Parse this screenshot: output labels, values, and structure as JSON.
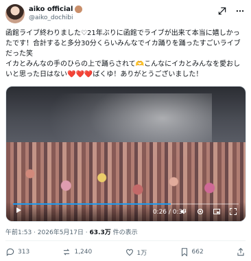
{
  "post": {
    "author_name": "aiko official",
    "author_handle": "@aiko_dochibi",
    "text": "函館ライブ終わりました♡21年ぶりに函館でライブが出来て本当に嬉しかったです！合計すると多分30分くらいみんなでイカ踊りを踊ったすごいライブだった笑\nイカとみんなの手のひらの上で踊らされて🫶こんなにイカとみんなを愛おしいと思った日はない❤️❤️❤️ばくゆ！ありがとうございました！",
    "timestamp": "午前1:53 · 2026年5月17日",
    "views_count": "63.3万",
    "views_label": "件の表示"
  },
  "video": {
    "time_display": "0:26 / 0:37",
    "progress_fraction": 0.7
  },
  "actions": {
    "replies": "313",
    "reposts": "1,240",
    "likes": "1万",
    "bookmarks": "662"
  },
  "colors": {
    "accent": "#1d9bf0",
    "text_secondary": "#536471",
    "text_primary": "#0f1419"
  },
  "icons": [
    "grok-icon",
    "more-icon",
    "play-icon",
    "volume-icon",
    "settings-icon",
    "picture-in-picture-icon",
    "fullscreen-icon",
    "reply-icon",
    "repost-icon",
    "like-icon",
    "bookmark-icon",
    "share-icon"
  ]
}
